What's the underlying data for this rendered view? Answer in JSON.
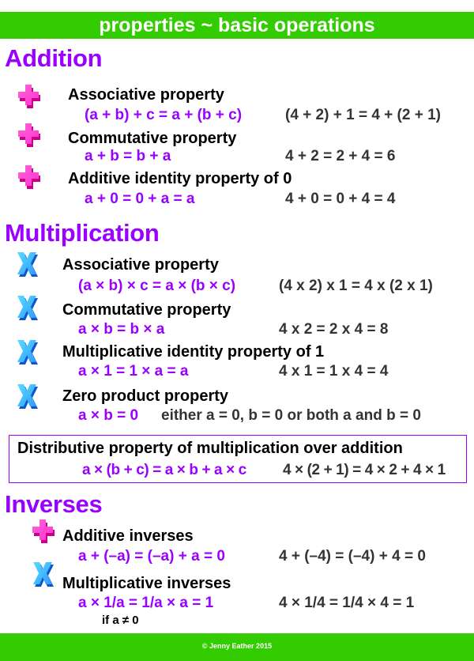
{
  "header": {
    "title": "properties ~ basic operations"
  },
  "addition": {
    "title": "Addition",
    "items": [
      {
        "icon": "plus-icon",
        "name": "Associative property",
        "formula": "(a + b) + c = a + (b + c)",
        "example": "(4 + 2) + 1 = 4 + (2 + 1)"
      },
      {
        "icon": "plus-icon",
        "name": "Commutative property",
        "formula": "a + b = b + a",
        "example": "4 + 2 = 2 + 4 = 6"
      },
      {
        "icon": "plus-icon",
        "name": "Additive identity property of 0",
        "formula": "a + 0 = 0 + a = a",
        "example": "4 + 0 = 0 + 4 = 4"
      }
    ]
  },
  "multiplication": {
    "title": "Multiplication",
    "items": [
      {
        "icon": "times-icon",
        "name": "Associative property",
        "formula": "(a × b) × c = a × (b × c)",
        "example": "(4 x 2) x 1 = 4 x (2 x 1)"
      },
      {
        "icon": "times-icon",
        "name": "Commutative property",
        "formula": "a × b = b × a",
        "example": "4 x 2 = 2 x 4 = 8"
      },
      {
        "icon": "times-icon",
        "name": "Multiplicative identity property of 1",
        "formula": "a × 1 = 1 × a = a",
        "example": "4 x 1 = 1 x 4 = 4"
      },
      {
        "icon": "times-icon",
        "name": "Zero product property",
        "formula": "a × b = 0",
        "example": "either a = 0, b = 0 or both a and b = 0"
      }
    ]
  },
  "distributive": {
    "name": "Distributive property of multiplication over addition",
    "formula": "a × (b + c) = a × b + a × c",
    "example": "4 × (2 + 1) = 4 × 2 + 4 × 1"
  },
  "inverses": {
    "title": "Inverses",
    "items": [
      {
        "icon": "plus-icon",
        "name": "Additive inverses",
        "formula": "a + (–a) = (–a) + a = 0",
        "example": "4 + (–4) = (–4) + 4 = 0"
      },
      {
        "icon": "times-icon",
        "name": "Multiplicative inverses",
        "formula": "a × 1/a = 1/a × a = 1",
        "example": "4 × 1/4 = 1/4 × 4 = 1",
        "note": "if a ≠ 0"
      }
    ]
  },
  "footer": {
    "copyright": "© Jenny Eather 2015"
  },
  "colors": {
    "banner": "#33cc00",
    "heading": "#9900ff",
    "plus_icon": "#ff33cc",
    "times_icon": "#3399ff"
  }
}
